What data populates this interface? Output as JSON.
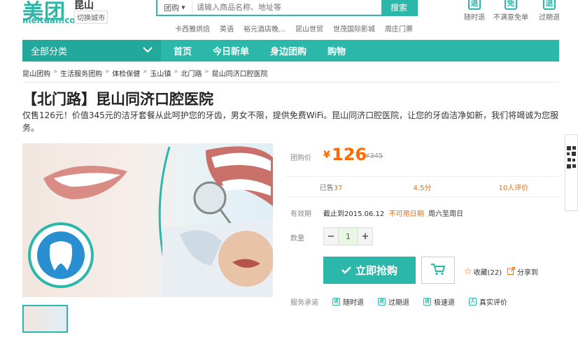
{
  "header": {
    "logo_text": "美团",
    "logo_domain": "meituan.com",
    "city": "昆山",
    "switch_city": "切换城市",
    "search": {
      "type": "团购",
      "placeholder": "请输入商品名称、地址等",
      "button": "搜索"
    },
    "hot_links": [
      "卡西雅烘焙",
      "英语",
      "裕元酒店晚…",
      "昆山世贸",
      "世茂国际影城",
      "周庄门票"
    ],
    "promises": [
      {
        "label": "随时退",
        "icon": "退"
      },
      {
        "label": "不满意免单",
        "icon": "免"
      },
      {
        "label": "过期退",
        "icon": "退"
      }
    ]
  },
  "nav": {
    "category": "全部分类",
    "items": [
      "首页",
      "今日新单",
      "身边团购",
      "购物"
    ]
  },
  "breadcrumb": [
    "昆山团购",
    "生活服务团购",
    "体检保健",
    "玉山镇",
    "北门路",
    "昆山同济口腔医院"
  ],
  "deal": {
    "title": "【北门路】昆山同济口腔医院",
    "description": "仅售126元！价值345元的洁牙套餐从此呵护您的牙齿，男女不限，提供免费WiFi。昆山同济口腔医院，让您的牙齿洁净如新，我们将竭诚为您服务。",
    "price_label": "团购价",
    "currency": "¥",
    "price": "126",
    "original_price": "¥345",
    "sold_label": "已售",
    "sold_count": "37",
    "rating": "4.5分",
    "reviews": "10人评价",
    "validity_label": "有效期",
    "validity": "截止到2015.06.12",
    "unavailable": "不可用日期",
    "unavailable_days": "周六至周日",
    "qty_label": "数量",
    "qty_value": "1",
    "buy_label": "立即抢购",
    "fav_label": "收藏(22)",
    "share_label": "分享到",
    "service_label": "服务承诺",
    "services": [
      "随时退",
      "过期退",
      "极速退",
      "真实评价"
    ]
  },
  "colors": {
    "brand": "#2bb8aa",
    "price": "#ff6a00"
  }
}
